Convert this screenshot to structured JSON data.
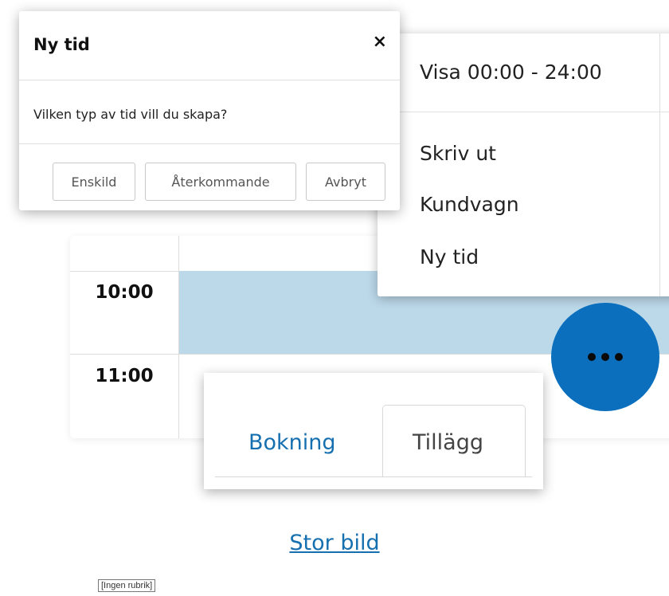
{
  "dialog": {
    "title": "Ny tid",
    "close_glyph": "×",
    "question": "Vilken typ av tid vill du skapa?",
    "buttons": {
      "single": "Enskild",
      "recurring": "Återkommande",
      "cancel": "Avbryt"
    }
  },
  "menu": {
    "items": [
      "Visa 00:00 - 24:00",
      "Skriv ut",
      "Kundvagn",
      "Ny tid"
    ]
  },
  "calendar": {
    "times": [
      "10:00",
      "11:00"
    ],
    "booked_color": "#bcd9ea"
  },
  "fab": {
    "icon": "more-dots-icon",
    "color": "#0b6fbd"
  },
  "tabs": {
    "items": [
      "Bokning",
      "Tillägg"
    ],
    "active": "Tillägg",
    "link_color": "#1670b0"
  },
  "links": {
    "big_image": "Stor bild"
  },
  "caption": {
    "label": "[Ingen rubrik]"
  }
}
